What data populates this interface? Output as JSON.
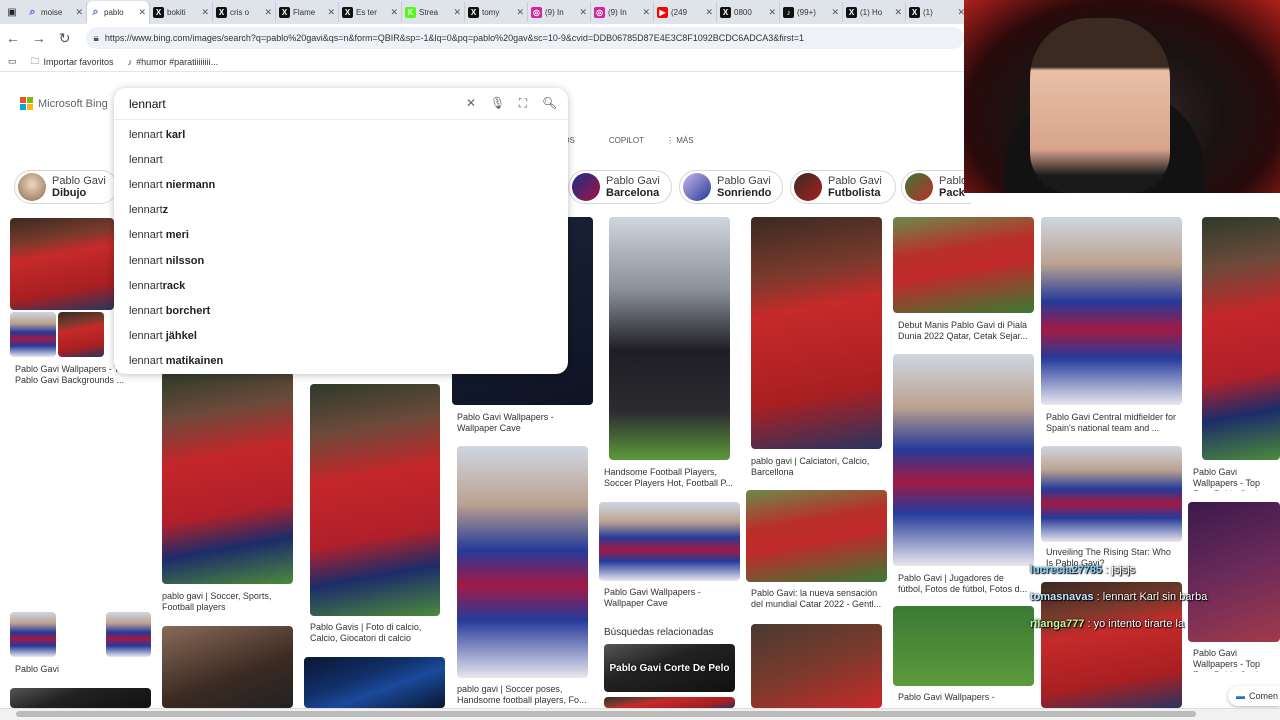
{
  "browser": {
    "tabs": [
      {
        "label": "moise",
        "icon": "search-icon",
        "color": "#4a6fd0"
      },
      {
        "label": "pablo",
        "icon": "search-icon",
        "color": "#4a6fd0",
        "active": true
      },
      {
        "label": "bokiti",
        "icon": "x-icon",
        "color": "#111111"
      },
      {
        "label": "cris o",
        "icon": "x-icon",
        "color": "#111111"
      },
      {
        "label": "Flame",
        "icon": "x-icon",
        "color": "#111111"
      },
      {
        "label": "Es ter",
        "icon": "x-icon",
        "color": "#111111"
      },
      {
        "label": "Strea",
        "icon": "kick-icon",
        "color": "#53fc18"
      },
      {
        "label": "tomy",
        "icon": "x-icon",
        "color": "#111111"
      },
      {
        "label": "(9) In",
        "icon": "instagram-icon",
        "color": "#d6249f"
      },
      {
        "label": "(9) In",
        "icon": "instagram-icon",
        "color": "#d6249f"
      },
      {
        "label": "(249",
        "icon": "youtube-icon",
        "color": "#ff0000"
      },
      {
        "label": "0800",
        "icon": "x-icon",
        "color": "#111111"
      },
      {
        "label": "(99+)",
        "icon": "tiktok-icon",
        "color": "#111111"
      },
      {
        "label": "(1) Ho",
        "icon": "x-icon",
        "color": "#111111"
      },
      {
        "label": "(1)",
        "icon": "x-icon",
        "color": "#111111"
      }
    ],
    "url": "https://www.bing.com/images/search?q=pablo%20gavi&qs=n&form=QBIR&sp=-1&lq=0&pq=pablo%20gav&sc=10-9&cvid=DDB06785D87E4E3C8F1092BCDC6ADCA3&first=1",
    "bookmarks": [
      {
        "label": "Importar favoritos",
        "icon": "folder-icon"
      },
      {
        "label": "#humor #paratiiiiiiii...",
        "icon": "tiktok-icon"
      }
    ]
  },
  "bing": {
    "logo_text": "Microsoft Bing",
    "search_value": "lennart",
    "suggestions": [
      {
        "prefix": "lennart",
        "rest": " karl"
      },
      {
        "prefix": "lennart",
        "rest": ""
      },
      {
        "prefix": "lennart",
        "rest": " niermann"
      },
      {
        "prefix": "lennart",
        "rest": "z"
      },
      {
        "prefix": "lennart",
        "rest": " meri"
      },
      {
        "prefix": "lennart",
        "rest": " nilsson"
      },
      {
        "prefix": "lennart",
        "rest": "rack"
      },
      {
        "prefix": "lennart",
        "rest": " borchert"
      },
      {
        "prefix": "lennart",
        "rest": " jähkel"
      },
      {
        "prefix": "lennart",
        "rest": " matikainen"
      }
    ],
    "scope_tabs": [
      "EOS",
      "COPILOT",
      "⋮ MÁS"
    ],
    "chips": [
      {
        "line1": "Pablo Gavi",
        "line2": "Dibujo"
      },
      {
        "line1": "Pablo Gavi",
        "line2": "Barcelona"
      },
      {
        "line1": "Pablo Gavi",
        "line2": "Sonriendo"
      },
      {
        "line1": "Pablo Gavi",
        "line2": "Futbolista"
      },
      {
        "line1": "Pablo",
        "line2": "Pack"
      }
    ],
    "captions": {
      "c1": "Pablo Gavi Wallpapers - Top Free Pablo Gavi Backgrounds ...",
      "c2": "Pablo Gavi",
      "c3": "pablo gavi | Soccer, Sports, Football players",
      "c4": "Pablo Gavis | Foto di calcio, Calcio, Giocatori di calcio",
      "c5": "Pablo Gavi Wallpapers - Wallpaper Cave",
      "c6": "pablo gavi | Soccer poses, Handsome football players, Fo...",
      "c7": "Handsome Football Players, Soccer Players Hot, Football P...",
      "c8": "Pablo Gavi Wallpapers - Wallpaper Cave",
      "c9": "pablo gavi | Calciatori, Calcio, Barcellona",
      "c10": "Pablo Gavi: la nueva sensación del mundial Catar 2022 - Gentl...",
      "c11": "Debut Manis Pablo Gavi di Piala Dunia 2022 Qatar, Cetak Sejar...",
      "c12": "Pablo Gavi | Jugadores de fútbol, Fotos de fútbol, Fotos d...",
      "c13": "Pablo Gavi Wallpapers - Wallpaper Cave",
      "c14": "Pablo Gavi Central midfielder for Spain's national team and ...",
      "c15": "Unveiling The Rising Star: Who Is Pablo Gavi?",
      "c16": "Pablo Gavi Wallpapers - Top Free Pablo Gavi Backgrounds",
      "c17": "Pablo Gavi Wallpapers - Top Free Pablo Gavi Backgro..."
    },
    "related_title": "Búsquedas relacionadas",
    "related_item": "Pablo Gavi Corte De Pelo",
    "comment_label": "Comen"
  },
  "stream": {
    "chat": [
      {
        "user": "lucrecia27785",
        "msg": " : jsjsjs",
        "color": "#7fd2ff"
      },
      {
        "user": "tomasnavas",
        "msg": " : lennart Karl sin barba",
        "color": "#bfe8ff"
      },
      {
        "user": "rilanga777",
        "msg": " : yo intento tirarte la",
        "color": "#b6ff9a"
      }
    ]
  }
}
